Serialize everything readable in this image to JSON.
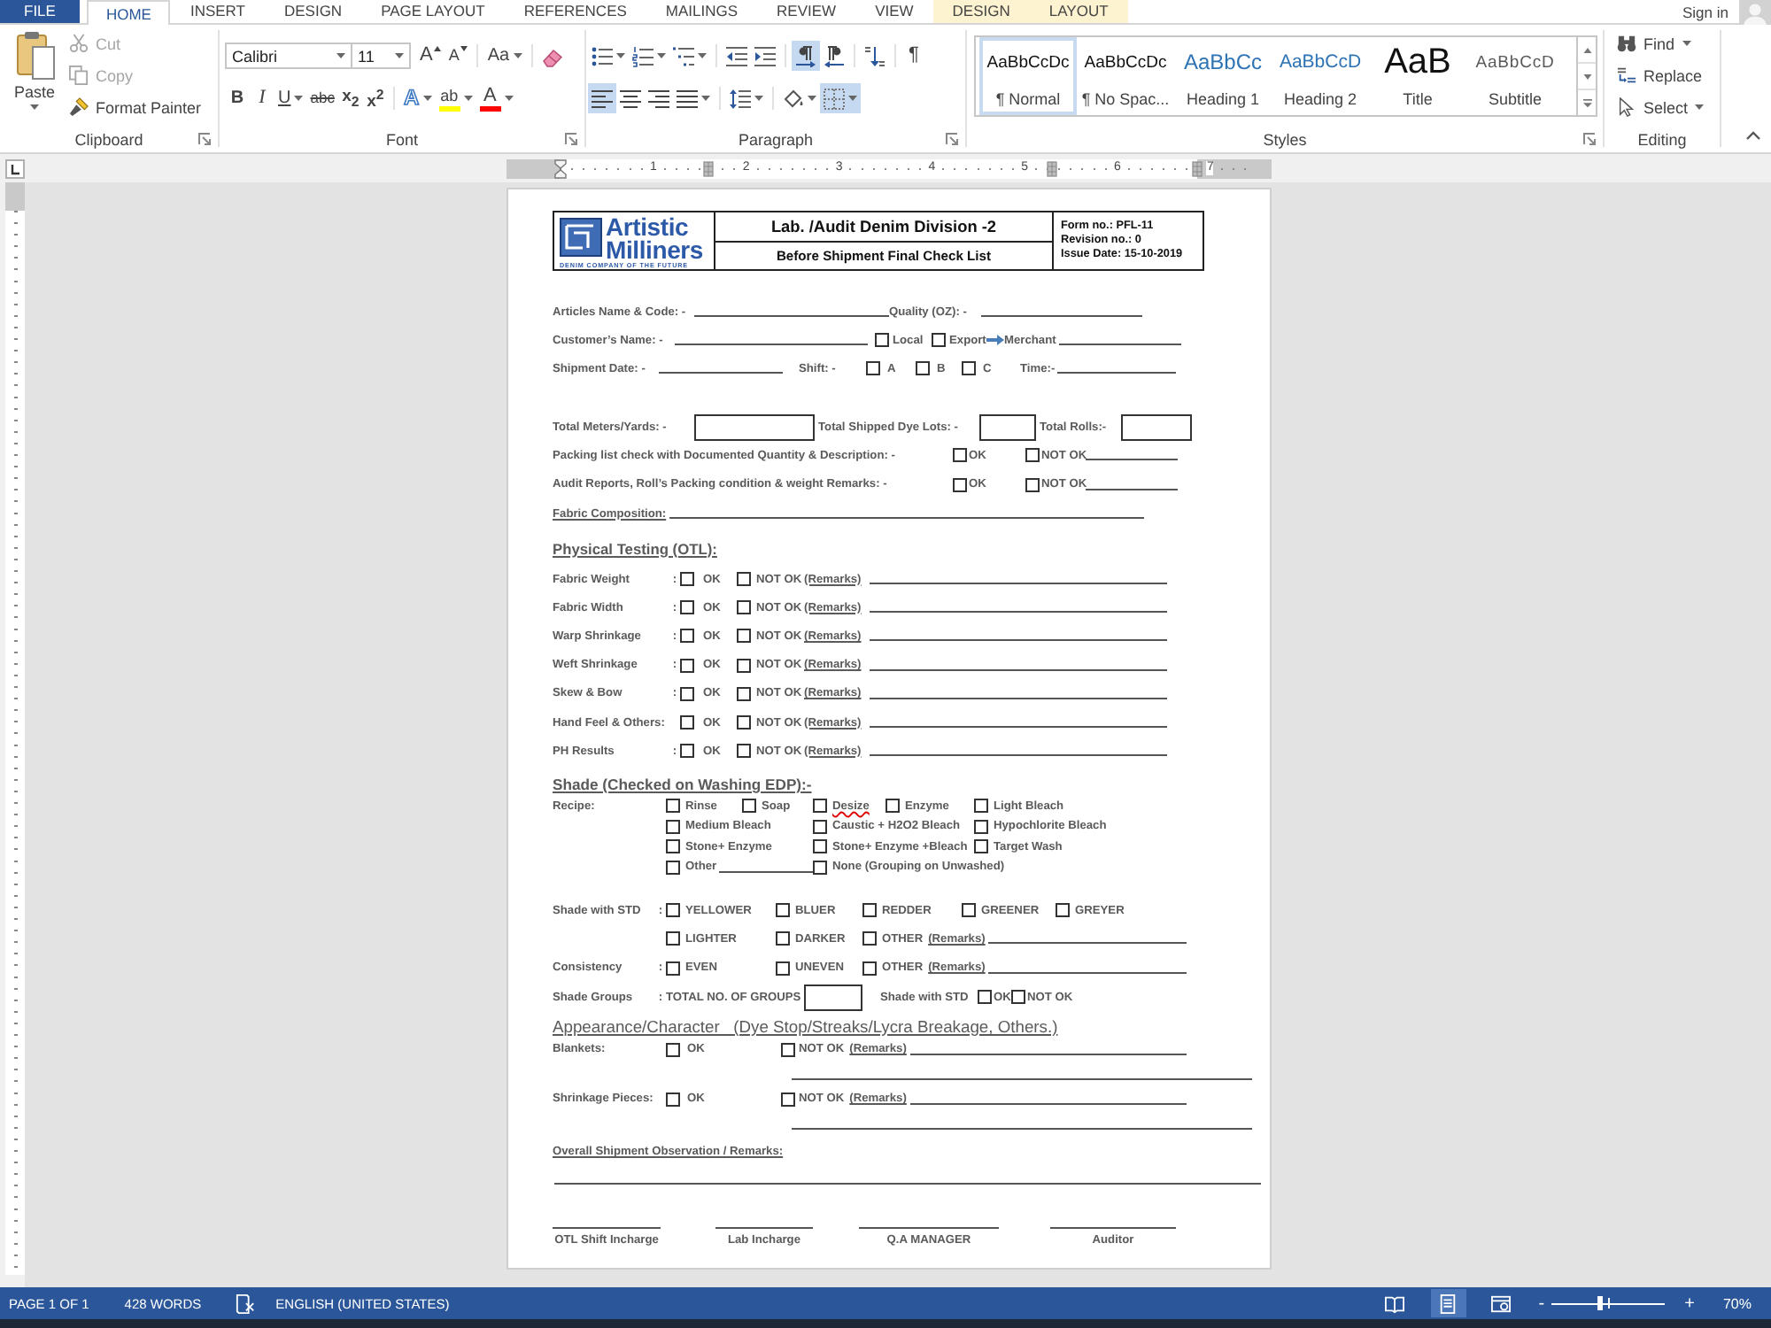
{
  "tabs": [
    {
      "label": "FILE",
      "kind": "file",
      "selected": false
    },
    {
      "label": "HOME",
      "kind": "main",
      "selected": true
    },
    {
      "label": "INSERT",
      "kind": "main",
      "selected": false
    },
    {
      "label": "DESIGN",
      "kind": "main",
      "selected": false
    },
    {
      "label": "PAGE LAYOUT",
      "kind": "main",
      "selected": false
    },
    {
      "label": "REFERENCES",
      "kind": "main",
      "selected": false
    },
    {
      "label": "MAILINGS",
      "kind": "main",
      "selected": false
    },
    {
      "label": "REVIEW",
      "kind": "main",
      "selected": false
    },
    {
      "label": "VIEW",
      "kind": "main",
      "selected": false
    },
    {
      "label": "DESIGN",
      "kind": "context",
      "selected": false
    },
    {
      "label": "LAYOUT",
      "kind": "context",
      "selected": false
    }
  ],
  "account": {
    "label": "Sign in"
  },
  "ribbon": {
    "clipboard": {
      "title": "Clipboard",
      "paste": "Paste",
      "items": [
        {
          "kind": "cut",
          "label": "Cut",
          "disabled": true
        },
        {
          "kind": "copy",
          "label": "Copy",
          "disabled": true
        },
        {
          "kind": "painter",
          "label": "Format Painter",
          "disabled": false
        }
      ]
    },
    "font": {
      "title": "Font",
      "family": "Calibri",
      "size": "11",
      "row1": [
        {
          "kind": "grow",
          "glyph": "A",
          "menu": false
        },
        {
          "kind": "shrink",
          "glyph": "A",
          "menu": false
        },
        {
          "kind": "case",
          "glyph": "Aa",
          "menu": true
        },
        {
          "kind": "clear",
          "menu": false
        }
      ],
      "row2": [
        {
          "kind": "bold",
          "glyph": "B",
          "menu": false
        },
        {
          "kind": "italic",
          "glyph": "I",
          "menu": false
        },
        {
          "kind": "underline",
          "glyph": "U",
          "menu": true
        },
        {
          "kind": "strike",
          "glyph": "abc",
          "menu": false
        },
        {
          "kind": "sub",
          "glyph": "x$_{2}$",
          "menu": false
        },
        {
          "kind": "sup",
          "glyph": "x$^{2}$",
          "menu": false
        },
        {
          "kind": "effects",
          "glyph": "A",
          "menu": true
        },
        {
          "kind": "highlight",
          "glyph": "ab",
          "menu": true,
          "color": "#ffff00"
        },
        {
          "kind": "color",
          "glyph": "A",
          "menu": true,
          "color": "#ff0000"
        }
      ]
    },
    "paragraph": {
      "title": "Paragraph",
      "row1": [
        {
          "kind": "bullets",
          "menu": true,
          "selected": false
        },
        {
          "kind": "numbering",
          "menu": true,
          "selected": false
        },
        {
          "kind": "multilevel",
          "menu": true,
          "selected": false
        },
        {
          "kind": "outdent",
          "menu": false,
          "selected": false
        },
        {
          "kind": "indent",
          "menu": false,
          "selected": false
        },
        {
          "kind": "ltr",
          "menu": false,
          "selected": true
        },
        {
          "kind": "rtl",
          "menu": false,
          "selected": false
        },
        {
          "kind": "sort",
          "menu": false,
          "selected": false
        },
        {
          "kind": "marks",
          "glyph": "¶",
          "menu": false,
          "selected": false
        }
      ],
      "row2": [
        {
          "kind": "left",
          "menu": false,
          "selected": true
        },
        {
          "kind": "center",
          "menu": false,
          "selected": false
        },
        {
          "kind": "right",
          "menu": false,
          "selected": false
        },
        {
          "kind": "justify",
          "menu": true,
          "selected": false
        },
        {
          "kind": "spacing",
          "menu": true,
          "selected": false
        },
        {
          "kind": "shading",
          "menu": true,
          "selected": false
        },
        {
          "kind": "borders",
          "menu": true,
          "selected": true
        }
      ]
    },
    "styles": {
      "title": "Styles",
      "items": [
        {
          "kind": "normal",
          "preview": "AaBbCcDc",
          "name": "¶ Normal",
          "selected": true
        },
        {
          "kind": "normal",
          "preview": "AaBbCcDc",
          "name": "¶ No Spac...",
          "selected": false
        },
        {
          "kind": "heading1",
          "preview": "AaBbCc",
          "name": "Heading 1",
          "selected": false
        },
        {
          "kind": "heading2",
          "preview": "AaBbCcD",
          "name": "Heading 2",
          "selected": false
        },
        {
          "kind": "title",
          "preview": "AaB",
          "name": "Title",
          "selected": false
        },
        {
          "kind": "subtitle",
          "preview": "AaBbCcD",
          "name": "Subtitle",
          "selected": false
        }
      ]
    },
    "editing": {
      "title": "Editing",
      "items": [
        {
          "kind": "find",
          "label": "Find",
          "menu": true
        },
        {
          "kind": "replace",
          "label": "Replace",
          "menu": false
        },
        {
          "kind": "select",
          "label": "Select",
          "menu": true
        }
      ]
    }
  },
  "ruler": {
    "marks": [
      "1",
      "2",
      "3",
      "4",
      "5",
      "6",
      "7"
    ]
  },
  "document": {
    "header": {
      "logo": {
        "lines": [
          "Artistic",
          "Milliners"
        ],
        "tagline": "DENIM COMPANY OF THE FUTURE"
      },
      "title": "Lab. /Audit Denim Division -2",
      "subtitle": "Before Shipment Final Check List",
      "info": [
        "Form no.: PFL-11",
        "Revision no.: 0",
        "Issue Date: 15-10-2019"
      ]
    },
    "articles": {
      "label": "Articles Name & Code: -",
      "quality_label": "Quality (OZ): -"
    },
    "customer": {
      "label": "Customer’s Name: -",
      "options": [
        {
          "label": "Local",
          "checked": false
        },
        {
          "label": "Export",
          "checked": false
        }
      ],
      "merchant_label": "Merchant"
    },
    "shipment": {
      "label": "Shipment Date: -",
      "shift_label": "Shift: -",
      "shifts": [
        {
          "label": "A",
          "checked": false
        },
        {
          "label": "B",
          "checked": false
        },
        {
          "label": "C",
          "checked": false
        }
      ],
      "time_label": "Time:-"
    },
    "totals": [
      "Total Meters/Yards: -",
      "Total Shipped Dye Lots: -",
      "Total Rolls:-"
    ],
    "checks": [
      {
        "label": "Packing list check with Documented Quantity & Description: -",
        "ok": {
          "label": "OK",
          "checked": false
        },
        "not_ok": {
          "label": "NOT OK",
          "checked": false
        }
      },
      {
        "label": "Audit Reports, Roll’s Packing condition & weight Remarks: -",
        "ok": {
          "label": "OK",
          "checked": false
        },
        "not_ok": {
          "label": "NOT OK",
          "checked": false
        }
      }
    ],
    "fabric_composition": "Fabric Composition:",
    "physical": {
      "heading": "Physical Testing (OTL):",
      "rows": [
        {
          "label": "Fabric Weight",
          "separator": ":",
          "ok": {
            "label": "OK",
            "checked": false
          },
          "not_ok": {
            "label": "NOT OK",
            "checked": false
          },
          "remarks": "(Remarks)"
        },
        {
          "label": "Fabric Width",
          "separator": ":",
          "ok": {
            "label": "OK",
            "checked": false
          },
          "not_ok": {
            "label": "NOT OK",
            "checked": false
          },
          "remarks": "(Remarks)"
        },
        {
          "label": "Warp Shrinkage",
          "separator": ":",
          "ok": {
            "label": "OK",
            "checked": false
          },
          "not_ok": {
            "label": "NOT OK",
            "checked": false
          },
          "remarks": "(Remarks)"
        },
        {
          "label": "Weft Shrinkage",
          "separator": ":",
          "ok": {
            "label": "OK",
            "checked": false
          },
          "not_ok": {
            "label": "NOT OK",
            "checked": false
          },
          "remarks": "(Remarks)"
        },
        {
          "label": "Skew & Bow",
          "separator": ":",
          "ok": {
            "label": "OK",
            "checked": false
          },
          "not_ok": {
            "label": "NOT OK",
            "checked": false
          },
          "remarks": "(Remarks)"
        },
        {
          "label": "Hand Feel & Others:",
          "ok": {
            "label": "OK",
            "checked": false
          },
          "not_ok": {
            "label": "NOT OK",
            "checked": false
          },
          "remarks": "(Remarks)"
        },
        {
          "label": "PH Results",
          "separator": ":",
          "ok": {
            "label": "OK",
            "checked": false
          },
          "not_ok": {
            "label": "NOT OK",
            "checked": false
          },
          "remarks": "(Remarks)"
        }
      ]
    },
    "shade": {
      "heading": "Shade (Checked on Washing EDP):-",
      "recipe_label": "Recipe:",
      "recipe": [
        [
          {
            "kind": "option",
            "label": "Rinse",
            "checked": false,
            "spell_error": false
          },
          {
            "kind": "option",
            "label": "Soap",
            "checked": false,
            "spell_error": false
          },
          {
            "kind": "option",
            "label": "Desize",
            "checked": false,
            "spell_error": true
          },
          {
            "kind": "option",
            "label": "Enzyme",
            "checked": false,
            "spell_error": false
          },
          {
            "kind": "option",
            "label": "Light Bleach",
            "checked": false,
            "spell_error": false
          }
        ],
        [
          {
            "kind": "option",
            "label": "Medium Bleach",
            "checked": false,
            "spell_error": false
          },
          {
            "kind": "option",
            "label": "Caustic + H2O2 Bleach",
            "checked": false,
            "spell_error": false
          },
          {
            "kind": "option",
            "label": "Hypochlorite Bleach",
            "checked": false,
            "spell_error": false
          }
        ],
        [
          {
            "kind": "option",
            "label": "Stone+ Enzyme",
            "checked": false,
            "spell_error": false
          },
          {
            "kind": "option",
            "label": "Stone+ Enzyme +Bleach",
            "checked": false,
            "spell_error": false
          },
          {
            "kind": "option",
            "label": "Target Wash",
            "checked": false,
            "spell_error": false
          }
        ],
        [
          {
            "kind": "option_line",
            "label": "Other",
            "checked": false,
            "spell_error": false
          },
          {
            "kind": "option",
            "label": "None (Grouping on Unwashed)",
            "checked": false,
            "spell_error": false
          }
        ]
      ],
      "std_rows": [
        {
          "label": "Shade with STD",
          "separator": ":",
          "options": [
            {
              "kind": "option",
              "label": "YELLOWER",
              "checked": false
            },
            {
              "kind": "option",
              "label": "BLUER",
              "checked": false
            },
            {
              "kind": "option",
              "label": "REDDER",
              "checked": false
            },
            {
              "kind": "option",
              "label": "GREENER",
              "checked": false
            },
            {
              "kind": "option",
              "label": "GREYER",
              "checked": false
            }
          ]
        },
        {
          "options": [
            {
              "kind": "option",
              "label": "LIGHTER",
              "checked": false
            },
            {
              "kind": "option",
              "label": "DARKER",
              "checked": false
            },
            {
              "kind": "other",
              "label": "OTHER",
              "checked": false,
              "remarks": "(Remarks)"
            }
          ]
        },
        {
          "label": "Consistency",
          "separator": ":",
          "options": [
            {
              "kind": "option",
              "label": "EVEN",
              "checked": false
            },
            {
              "kind": "option",
              "label": "UNEVEN",
              "checked": false
            },
            {
              "kind": "other",
              "label": "OTHER",
              "checked": false,
              "remarks": "(Remarks)"
            }
          ]
        }
      ],
      "groups": {
        "label": "Shade Groups",
        "separator": ":",
        "total_label": "TOTAL NO. OF GROUPS",
        "std_label": "Shade with STD",
        "ok": {
          "label": "OK",
          "checked": false
        },
        "not_ok": {
          "label": "NOT OK",
          "checked": false
        }
      }
    },
    "appearance": {
      "heading": "Appearance/Character   (Dye Stop/Streaks/Lycra Breakage, Others.)",
      "rows": [
        {
          "label": "Blankets:",
          "ok": {
            "label": "OK",
            "checked": false
          },
          "not_ok": {
            "label": "NOT OK",
            "checked": false
          },
          "remarks": "(Remarks)"
        },
        {
          "label": "Shrinkage Pieces:",
          "ok": {
            "label": "OK",
            "checked": false
          },
          "not_ok": {
            "label": "NOT OK",
            "checked": false
          },
          "remarks": "(Remarks)"
        }
      ]
    },
    "observation": "Overall Shipment Observation / Remarks:",
    "signatures": [
      "OTL Shift Incharge",
      "Lab Incharge",
      "Q.A MANAGER",
      "Auditor"
    ]
  },
  "status_bar": {
    "page": "PAGE 1 OF 1",
    "words": "428 WORDS",
    "language": "ENGLISH (UNITED STATES)",
    "views": [
      {
        "kind": "read",
        "selected": false
      },
      {
        "kind": "print",
        "selected": true
      },
      {
        "kind": "web",
        "selected": false
      }
    ],
    "zoom_out": "-",
    "zoom_in": "+",
    "zoom": {
      "level": 0.43
    },
    "zoom_label": "70%"
  }
}
